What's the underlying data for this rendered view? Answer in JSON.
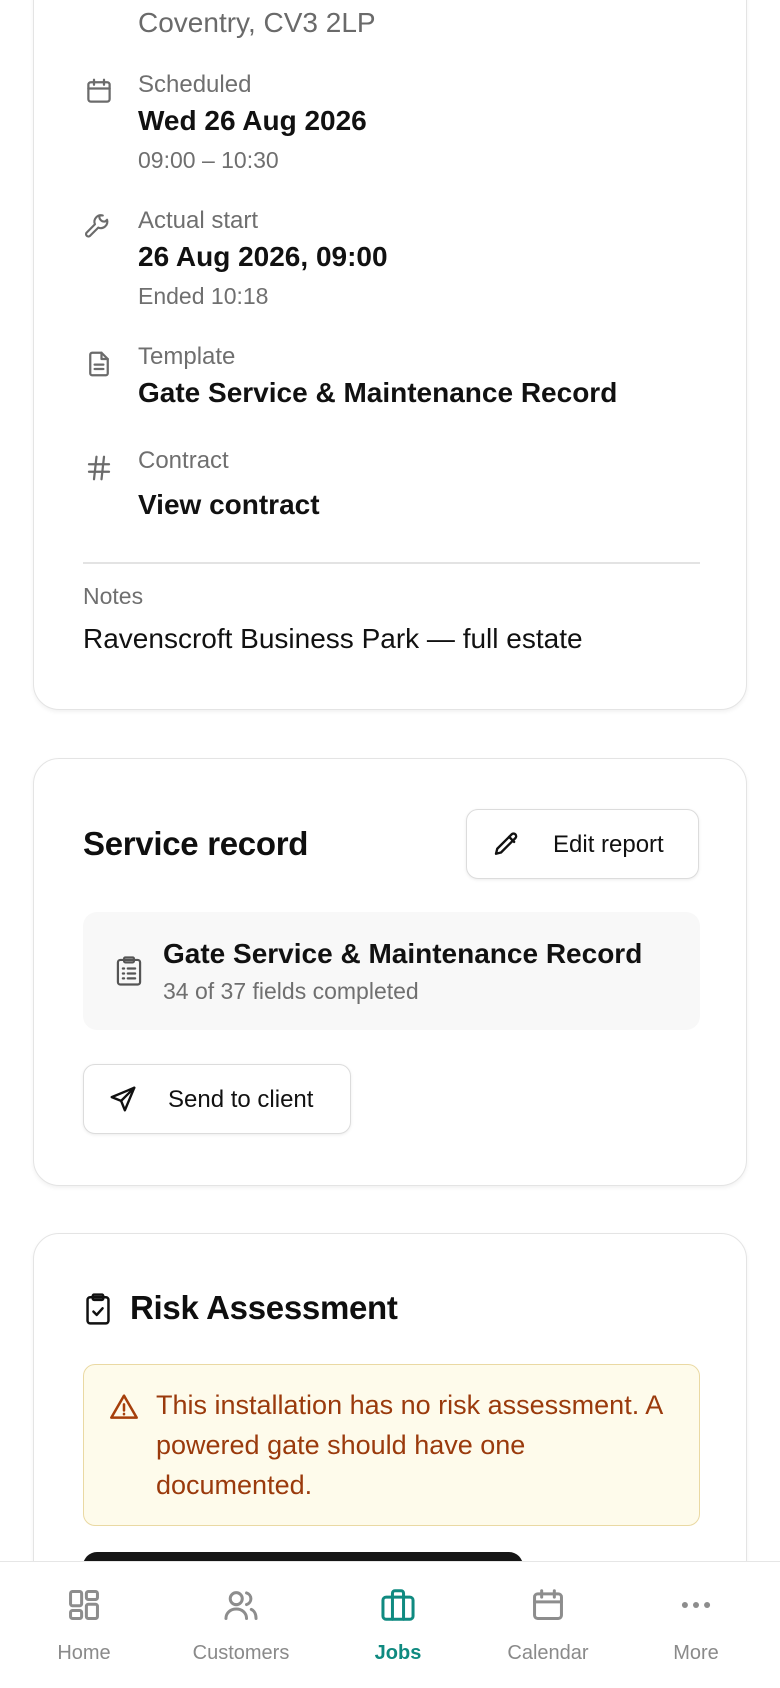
{
  "details": {
    "address_line": "Coventry, CV3 2LP",
    "scheduled": {
      "label": "Scheduled",
      "value": "Wed 26 Aug 2026",
      "sub": "09:00 – 10:30"
    },
    "actual_start": {
      "label": "Actual start",
      "value": "26 Aug 2026, 09:00",
      "sub": "Ended 10:18"
    },
    "template": {
      "label": "Template",
      "value": "Gate Service & Maintenance Record"
    },
    "contract": {
      "label": "Contract",
      "value": "View contract"
    },
    "notes": {
      "label": "Notes",
      "value": "Ravenscroft Business Park — full estate"
    }
  },
  "service_record": {
    "title": "Service record",
    "edit_label": "Edit report",
    "form_title": "Gate Service & Maintenance Record",
    "form_progress": "34 of 37 fields completed",
    "send_label": "Send to client"
  },
  "risk": {
    "title": "Risk Assessment",
    "warning": "This installation has no risk assessment. A powered gate should have one documented."
  },
  "tabs": [
    {
      "label": "Home",
      "icon": "grid-icon",
      "active": false
    },
    {
      "label": "Customers",
      "icon": "users-icon",
      "active": false
    },
    {
      "label": "Jobs",
      "icon": "briefcase-icon",
      "active": true
    },
    {
      "label": "Calendar",
      "icon": "calendar-icon",
      "active": false
    },
    {
      "label": "More",
      "icon": "more-icon",
      "active": false
    }
  ],
  "colors": {
    "accent": "#0f8a80",
    "warning_text": "#9a3a0c",
    "warning_bg": "#fefbeb"
  }
}
